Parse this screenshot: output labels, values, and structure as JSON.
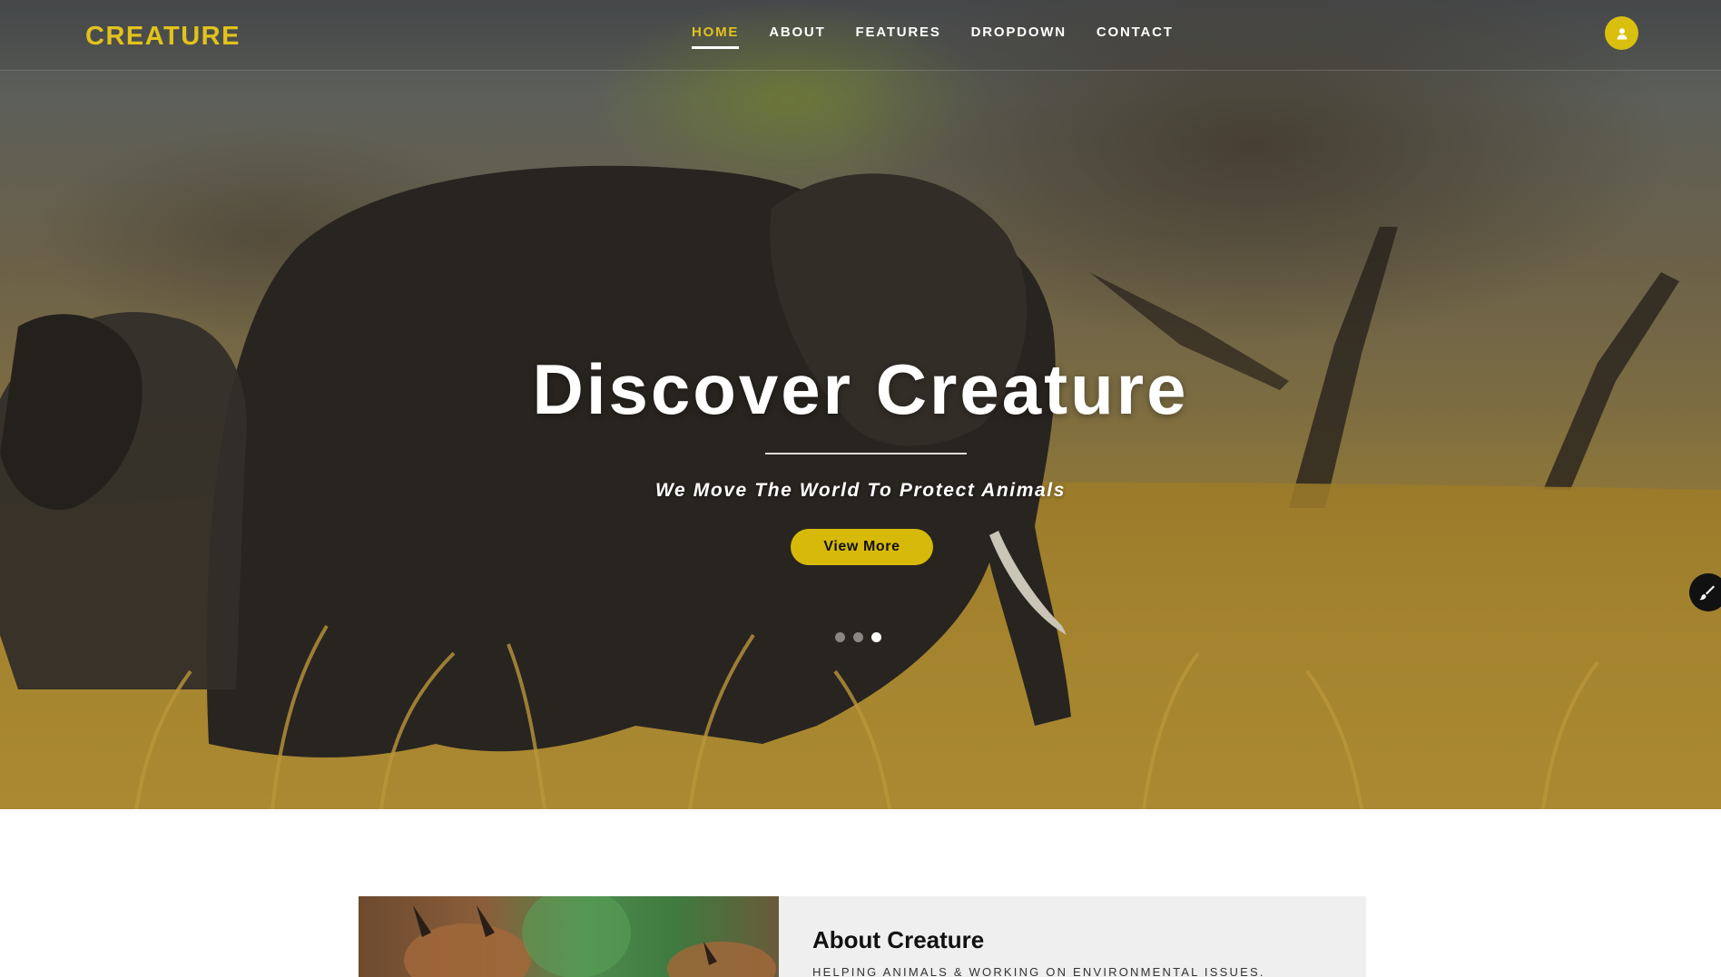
{
  "brand": {
    "name": "CREATURE"
  },
  "nav": {
    "items": [
      {
        "label": "HOME",
        "active": true
      },
      {
        "label": "ABOUT",
        "active": false
      },
      {
        "label": "FEATURES",
        "active": false
      },
      {
        "label": "DROPDOWN",
        "active": false
      },
      {
        "label": "CONTACT",
        "active": false
      }
    ],
    "user_icon": "user-icon"
  },
  "hero": {
    "title": "Discover Creature",
    "subtitle": "We Move The World To Protect Animals",
    "button_label": "View More",
    "slides": {
      "count": 3,
      "active_index": 2
    },
    "side_tool_icon": "paint-brush-icon"
  },
  "about": {
    "title": "About Creature",
    "subtitle": "HELPING ANIMALS & WORKING ON ENVIRONMENTAL ISSUES."
  },
  "colors": {
    "accent": "#e2c21c",
    "button": "#d7b909",
    "about_card_bg": "#efefef"
  }
}
